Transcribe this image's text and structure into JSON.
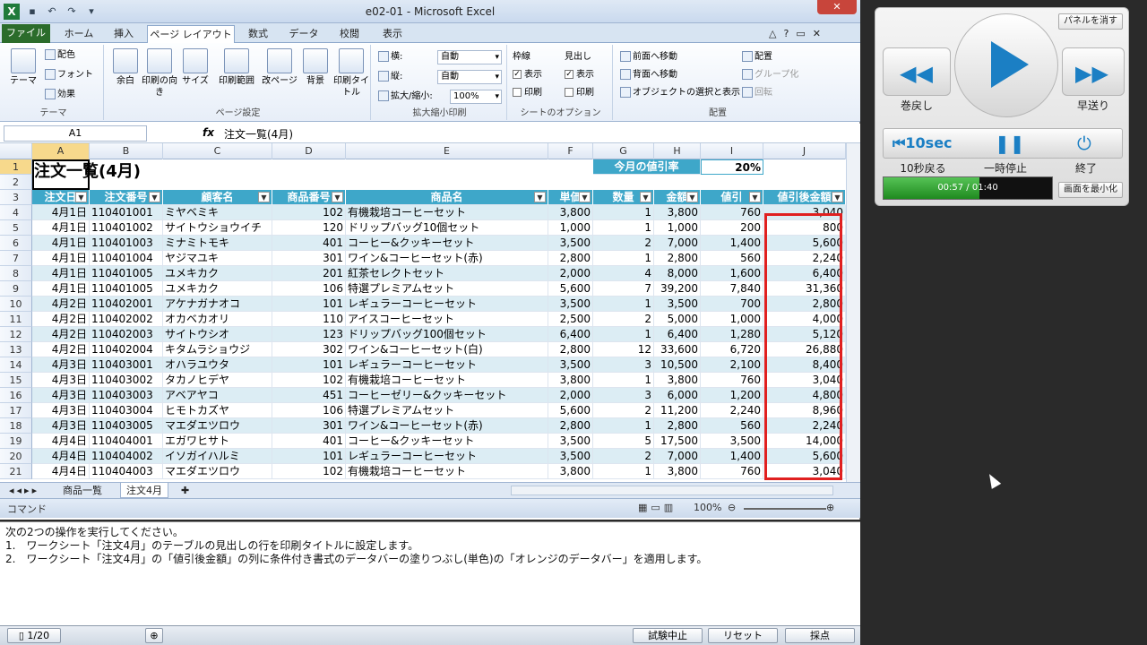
{
  "window": {
    "title": "e02-01 - Microsoft Excel",
    "close_icon": "close-icon"
  },
  "ribbon_tabs": [
    "ファイル",
    "ホーム",
    "挿入",
    "ページ レイアウト",
    "数式",
    "データ",
    "校閲",
    "表示"
  ],
  "ribbon": {
    "theme": {
      "theme": "テーマ",
      "colors": "配色",
      "fonts": "フォント",
      "effects": "効果",
      "label": "テーマ"
    },
    "page_setup": {
      "margins": "余白",
      "orientation": "印刷の向き",
      "size": "サイズ",
      "print_area": "印刷範囲",
      "breaks": "改ページ",
      "background": "背景",
      "print_titles": "印刷タイトル",
      "label": "ページ設定"
    },
    "scale": {
      "width_label": "横:",
      "width_value": "自動",
      "height_label": "縦:",
      "height_value": "自動",
      "scale_label": "拡大/縮小:",
      "scale_value": "100%",
      "label": "拡大縮小印刷"
    },
    "sheet_options": {
      "gridlines": "枠線",
      "headings": "見出し",
      "view": "表示",
      "print": "印刷",
      "label": "シートのオプション"
    },
    "arrange": {
      "bring_forward": "前面へ移動",
      "send_backward": "背面へ移動",
      "selection_pane": "オブジェクトの選択と表示",
      "align": "配置",
      "group": "グループ化",
      "rotate": "回転",
      "label": "配置"
    }
  },
  "formula_bar": {
    "name_box": "A1",
    "fx": "fx",
    "content": "注文一覧(4月)"
  },
  "columns": [
    "A",
    "B",
    "C",
    "D",
    "E",
    "F",
    "G",
    "H",
    "I",
    "J"
  ],
  "sheet": {
    "title": "注文一覧(4月)",
    "discount_label": "今月の値引率",
    "discount_value": "20%",
    "headers": [
      "注文日",
      "注文番号",
      "顧客名",
      "商品番号",
      "商品名",
      "単価",
      "数量",
      "金額",
      "値引",
      "値引後金額"
    ],
    "rows": [
      [
        "4月1日",
        "110401001",
        "ミヤベミキ",
        "102",
        "有機栽培コーヒーセット",
        "3,800",
        "1",
        "3,800",
        "760",
        "3,040"
      ],
      [
        "4月1日",
        "110401002",
        "サイトウショウイチ",
        "120",
        "ドリップバッグ10個セット",
        "1,000",
        "1",
        "1,000",
        "200",
        "800"
      ],
      [
        "4月1日",
        "110401003",
        "ミナミトモキ",
        "401",
        "コーヒー&クッキーセット",
        "3,500",
        "2",
        "7,000",
        "1,400",
        "5,600"
      ],
      [
        "4月1日",
        "110401004",
        "ヤジマユキ",
        "301",
        "ワイン&コーヒーセット(赤)",
        "2,800",
        "1",
        "2,800",
        "560",
        "2,240"
      ],
      [
        "4月1日",
        "110401005",
        "ユメキカク",
        "201",
        "紅茶セレクトセット",
        "2,000",
        "4",
        "8,000",
        "1,600",
        "6,400"
      ],
      [
        "4月1日",
        "110401005",
        "ユメキカク",
        "106",
        "特選プレミアムセット",
        "5,600",
        "7",
        "39,200",
        "7,840",
        "31,360"
      ],
      [
        "4月2日",
        "110402001",
        "アケナガナオコ",
        "101",
        "レギュラーコーヒーセット",
        "3,500",
        "1",
        "3,500",
        "700",
        "2,800"
      ],
      [
        "4月2日",
        "110402002",
        "オカベカオリ",
        "110",
        "アイスコーヒーセット",
        "2,500",
        "2",
        "5,000",
        "1,000",
        "4,000"
      ],
      [
        "4月2日",
        "110402003",
        "サイトウシオ",
        "123",
        "ドリップバッグ100個セット",
        "6,400",
        "1",
        "6,400",
        "1,280",
        "5,120"
      ],
      [
        "4月2日",
        "110402004",
        "キタムラショウジ",
        "302",
        "ワイン&コーヒーセット(白)",
        "2,800",
        "12",
        "33,600",
        "6,720",
        "26,880"
      ],
      [
        "4月3日",
        "110403001",
        "オハラユウタ",
        "101",
        "レギュラーコーヒーセット",
        "3,500",
        "3",
        "10,500",
        "2,100",
        "8,400"
      ],
      [
        "4月3日",
        "110403002",
        "タカノヒデヤ",
        "102",
        "有機栽培コーヒーセット",
        "3,800",
        "1",
        "3,800",
        "760",
        "3,040"
      ],
      [
        "4月3日",
        "110403003",
        "アベアヤコ",
        "451",
        "コーヒーゼリー&クッキーセット",
        "2,000",
        "3",
        "6,000",
        "1,200",
        "4,800"
      ],
      [
        "4月3日",
        "110403004",
        "ヒモトカズヤ",
        "106",
        "特選プレミアムセット",
        "5,600",
        "2",
        "11,200",
        "2,240",
        "8,960"
      ],
      [
        "4月3日",
        "110403005",
        "マエダエツロウ",
        "301",
        "ワイン&コーヒーセット(赤)",
        "2,800",
        "1",
        "2,800",
        "560",
        "2,240"
      ],
      [
        "4月4日",
        "110404001",
        "エガワヒサト",
        "401",
        "コーヒー&クッキーセット",
        "3,500",
        "5",
        "17,500",
        "3,500",
        "14,000"
      ],
      [
        "4月4日",
        "110404002",
        "イソガイハルミ",
        "101",
        "レギュラーコーヒーセット",
        "3,500",
        "2",
        "7,000",
        "1,400",
        "5,600"
      ],
      [
        "4月4日",
        "110404003",
        "マエダエツロウ",
        "102",
        "有機栽培コーヒーセット",
        "3,800",
        "1",
        "3,800",
        "760",
        "3,040"
      ]
    ]
  },
  "sheet_tabs": [
    "商品一覧",
    "注文4月"
  ],
  "status": {
    "mode": "コマンド",
    "zoom": "100%"
  },
  "task": {
    "intro": "次の2つの操作を実行してください。",
    "items": [
      "1.　ワークシート「注文4月」のテーブルの見出しの行を印刷タイトルに設定します。",
      "2.　ワークシート「注文4月」の「値引後金額」の列に条件付き書式のデータバーの塗りつぶし(単色)の「オレンジのデータバー」を適用します。"
    ]
  },
  "bottom_bar": {
    "page": "1/20",
    "stop": "試験中止",
    "reset": "リセット",
    "grade": "採点"
  },
  "player": {
    "hide_panel": "パネルを消す",
    "rewind": "巻戻し",
    "fast_forward": "早送り",
    "back10_btn": "10sec",
    "back10": "10秒戻る",
    "pause": "一時停止",
    "quit": "終了",
    "time": "00:57 / 01:40",
    "progress": 0.57,
    "minimize": "画面を最小化"
  },
  "colors": {
    "table_header": "#3ea7c9",
    "band": "#dcedf4",
    "highlight": "#e02020",
    "file_tab": "#2b6c2b"
  }
}
